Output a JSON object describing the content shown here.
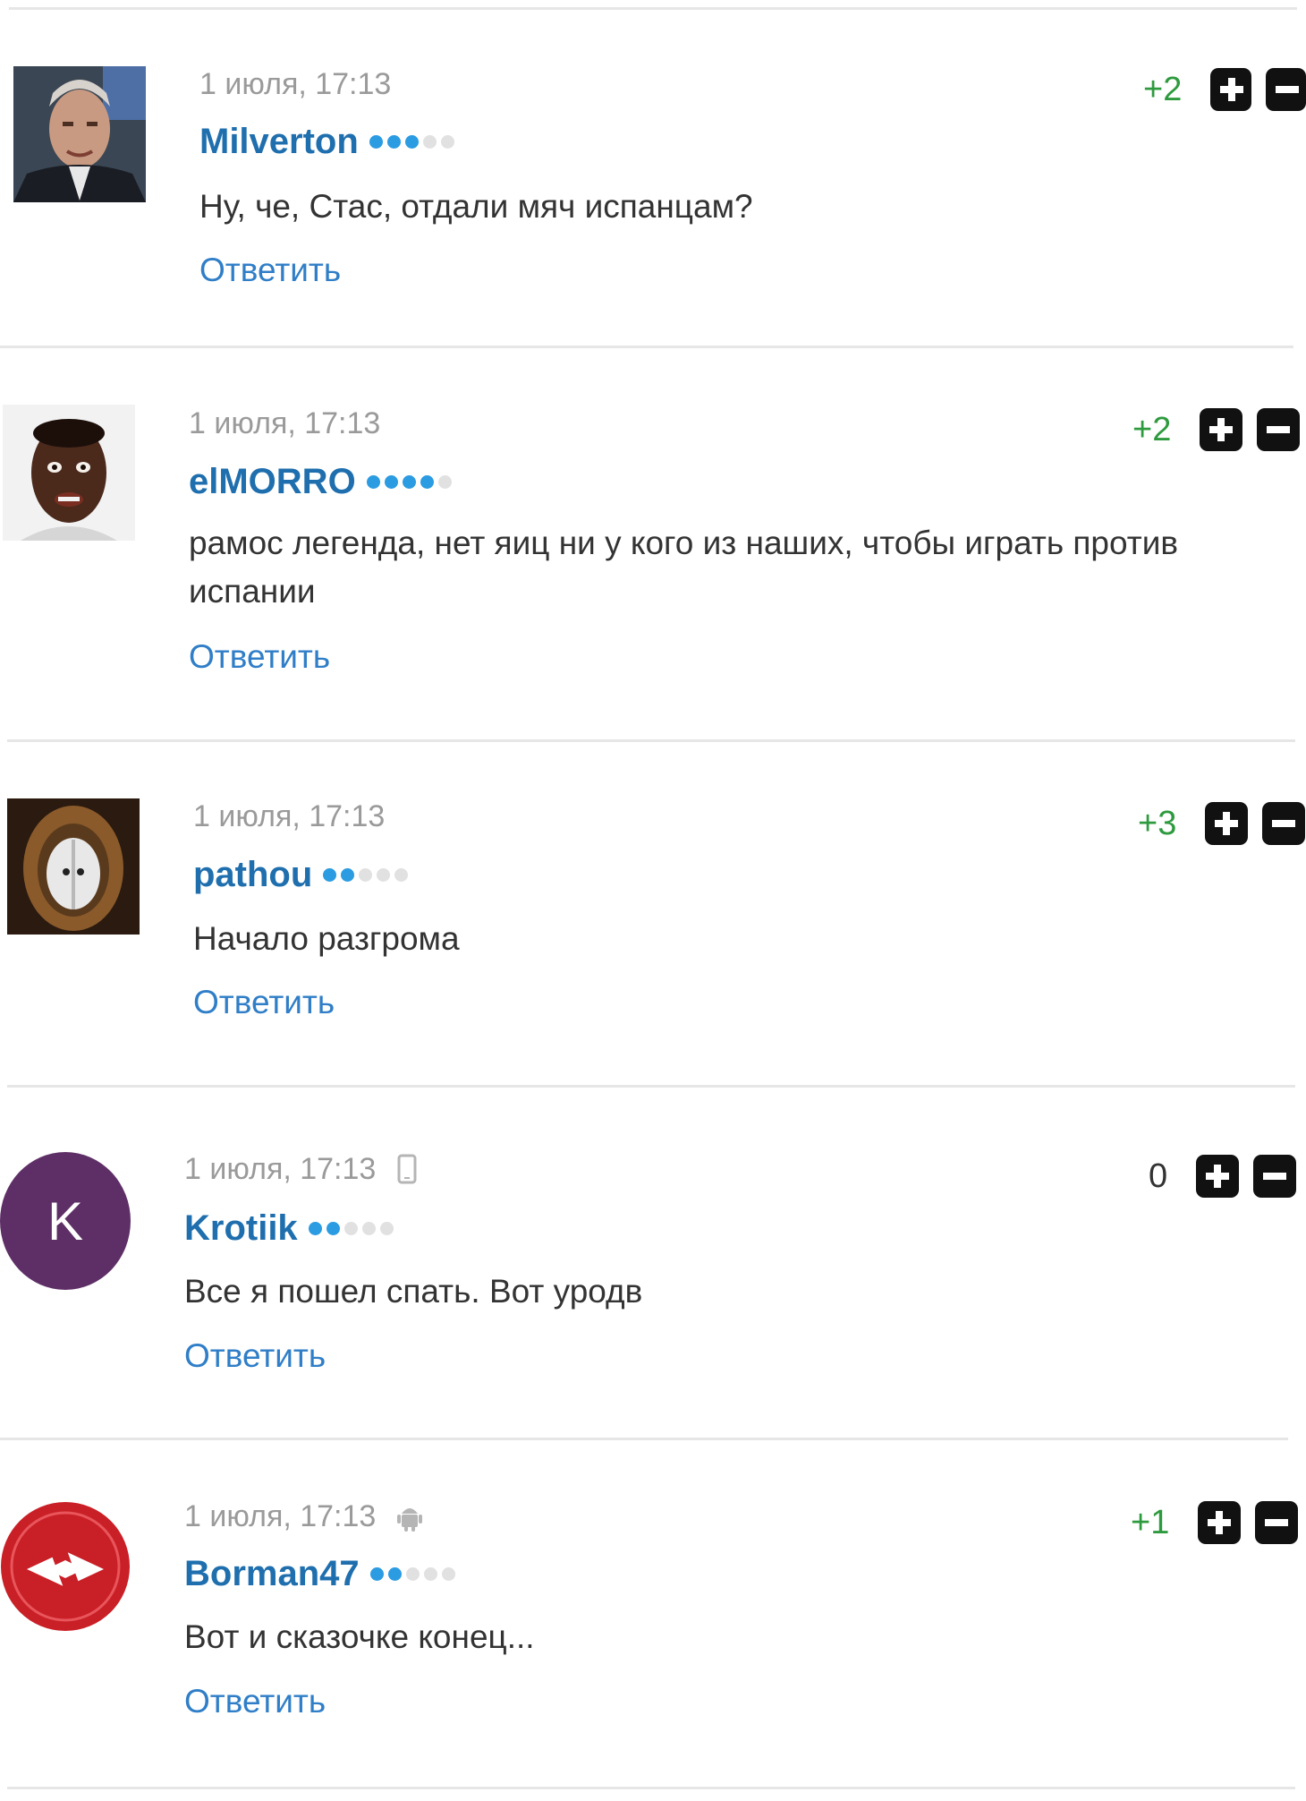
{
  "comments": [
    {
      "date": "1 июля, 17:13",
      "author": "Milverton",
      "text": "Ну, че, Стас, отдали мяч испанцам?",
      "reply": "Ответить",
      "score": "+2",
      "rating_level": 3,
      "device": null
    },
    {
      "date": "1 июля, 17:13",
      "author": "elMORRO",
      "text": "рамос легенда, нет яиц ни у кого из наших, чтобы играть против испании",
      "reply": "Ответить",
      "score": "+2",
      "rating_level": 4,
      "device": null
    },
    {
      "date": "1 июля, 17:13",
      "author": "pathou",
      "text": "Начало разгрома",
      "reply": "Ответить",
      "score": "+3",
      "rating_level": 2,
      "device": null
    },
    {
      "date": "1 июля, 17:13",
      "author": "Krotiik",
      "text": "Все я пошел спать. Вот уродв",
      "reply": "Ответить",
      "score": "0",
      "rating_level": 2,
      "device": "phone-icon",
      "avatar_letter": "K",
      "avatar_color": "#5e2f66"
    },
    {
      "date": "1 июля, 17:13",
      "author": "Borman47",
      "text": "Вот и сказочке конец...",
      "reply": "Ответить",
      "score": "+1",
      "rating_level": 2,
      "device": "android-icon"
    }
  ],
  "colors": {
    "author": "#1f6fae",
    "reply": "#2f7ec7",
    "positive_score": "#2e9a3e",
    "rating_on": "#2b9be2",
    "rating_off": "#e1e1e1"
  }
}
